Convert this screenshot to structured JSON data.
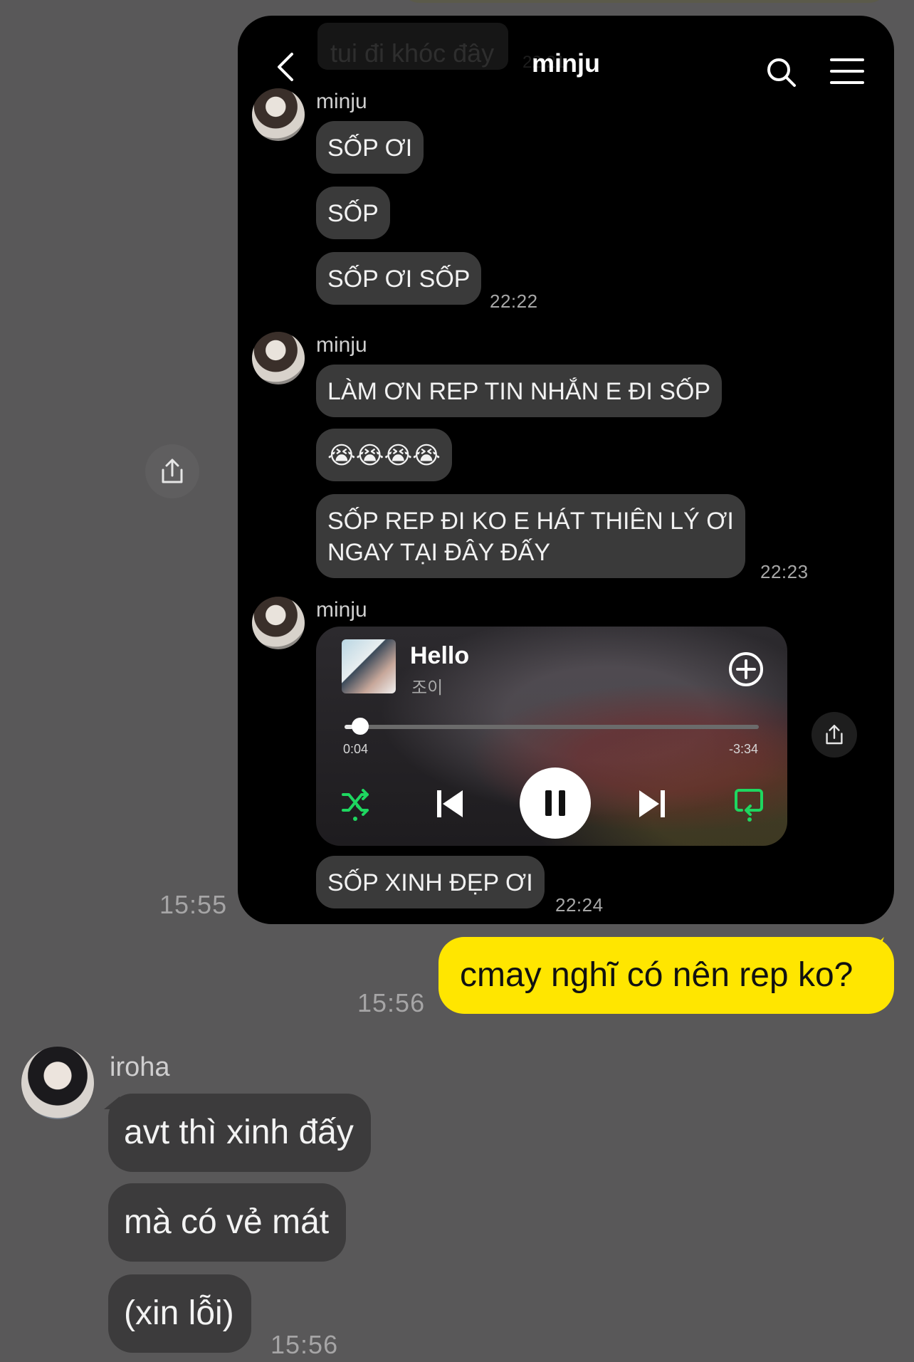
{
  "outer_chat": {
    "screenshot_time": "15:55",
    "my_message": {
      "text": "cmay nghĩ có nên rep ko?",
      "time": "15:56"
    },
    "reply": {
      "sender": "iroha",
      "messages": [
        "avt thì xinh đấy",
        "mà có vẻ mát",
        "(xin lỗi)"
      ],
      "time": "15:56"
    }
  },
  "screenshot": {
    "title": "minju",
    "ghost_text": "tui đi khóc đây",
    "groups": [
      {
        "sender": "minju",
        "messages": [
          "SỐP ƠI",
          "SỐP",
          "SỐP ƠI SỐP"
        ],
        "time": "22:22"
      },
      {
        "sender": "minju",
        "messages": [
          "LÀM ƠN REP TIN NHẮN E ĐI SỐP",
          "😭😭😭😭",
          "SỐP REP ĐI KO E HÁT THIÊN LÝ ƠI\nNGAY TẠI ĐÂY ĐẤY"
        ],
        "time": "22:23"
      },
      {
        "sender": "minju",
        "messages": [
          "SỐP XINH ĐẸP ƠI"
        ],
        "time": "22:24"
      }
    ],
    "music": {
      "title": "Hello",
      "artist": "조이",
      "elapsed": "0:04",
      "remaining": "-3:34",
      "progress": 0.02
    }
  },
  "colors": {
    "accent_yellow": "#ffe600",
    "spotify_green": "#1ed760"
  }
}
